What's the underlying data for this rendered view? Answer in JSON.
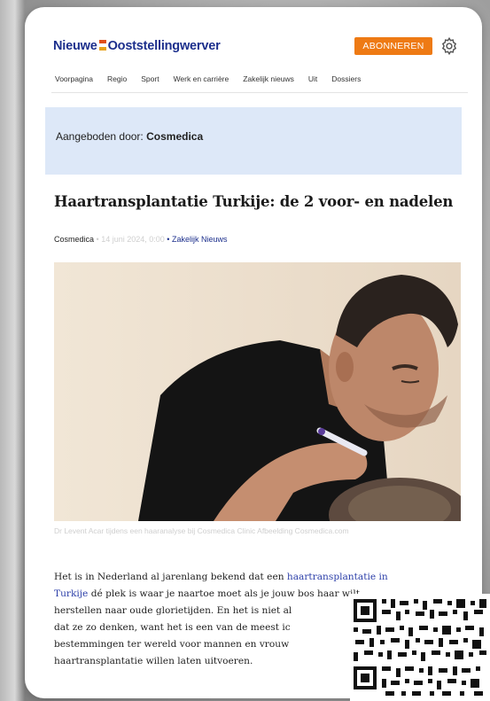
{
  "header": {
    "logo_part1": "Nieuwe",
    "logo_part2": "Ooststellingwerver",
    "subscribe_label": "ABONNEREN",
    "settings_icon": "gear-icon"
  },
  "nav": {
    "items": [
      {
        "label": "Voorpagina"
      },
      {
        "label": "Regio"
      },
      {
        "label": "Sport"
      },
      {
        "label": "Werk en carrière"
      },
      {
        "label": "Zakelijk nieuws"
      },
      {
        "label": "Uit"
      },
      {
        "label": "Dossiers"
      }
    ]
  },
  "sponsor": {
    "prefix": "Aangeboden door:",
    "name": "Cosmedica"
  },
  "article": {
    "title": "Haartransplantatie Turkije: de 2 voor- en nadelen",
    "author": "Cosmedica",
    "separator": "•",
    "date": "14 juni 2024, 0:00",
    "category": "Zakelijk Nieuws",
    "caption": "Dr Levent Acar tijdens een haaranalyse bij Cosmedica Clinic Afbeelding Cosmedica.com",
    "p_line1_a": "Het is in Nederland al jarenlang bekend dat een ",
    "p_link_a": "haartransplantatie in",
    "p_link_b": "Turkije",
    "p_line2_b": " dé plek is waar je naartoe moet als je jouw bos haar wilt",
    "p_line3": "herstellen naar oude glorietijden. En het is niet al",
    "p_line4": "dat ze zo denken, want het is een van de meest ic",
    "p_line5": "bestemmingen ter wereld voor mannen en vrouw",
    "p_line6": "haartransplantatie willen laten uitvoeren."
  },
  "colors": {
    "brand_blue": "#1c2f8c",
    "subscribe_orange": "#ee7a14",
    "sponsor_bg": "#dde8f8",
    "link": "#2b3ea8"
  }
}
